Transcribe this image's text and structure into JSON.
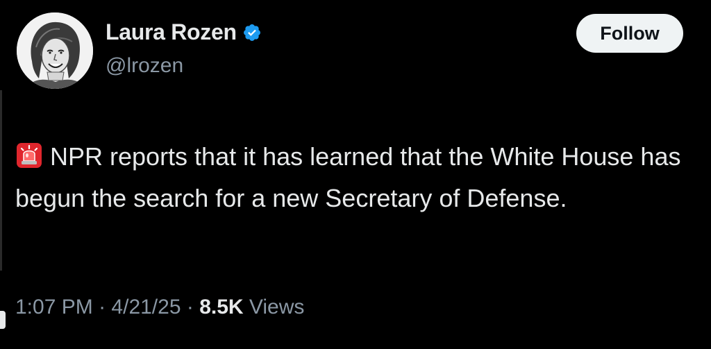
{
  "author": {
    "display_name": "Laura Rozen",
    "handle": "@lrozen",
    "avatar_icon": "caricature-portrait-avatar",
    "verified_icon": "verified-badge-icon",
    "verified_color": "#1d9bf0"
  },
  "follow_button": {
    "label": "Follow"
  },
  "tweet": {
    "emoji_icon": "police-siren-icon",
    "text": "NPR reports that it has learned that the White House has begun the search for a new Secretary of Defense."
  },
  "meta": {
    "time": "1:07 PM",
    "separator": "·",
    "date": "4/21/25",
    "views_count": "8.5K",
    "views_label": "Views"
  },
  "colors": {
    "background": "#000000",
    "primary_text": "#e7e9ea",
    "secondary_text": "#8b98a5",
    "follow_bg": "#eff3f4"
  }
}
